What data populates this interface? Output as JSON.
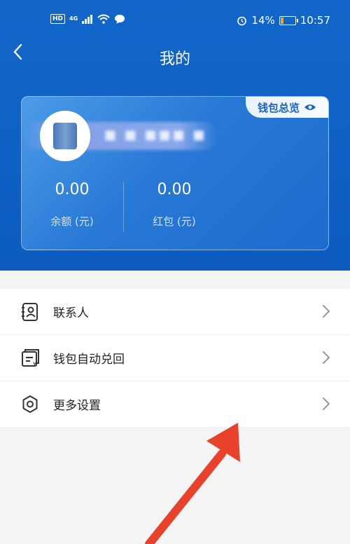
{
  "status_bar": {
    "hd": "HD",
    "network": "4G",
    "battery": "14%",
    "time": "10:57"
  },
  "nav": {
    "back_icon": "chevron-left-icon",
    "title": "我的"
  },
  "wallet": {
    "overview_label": "钱包总览",
    "overview_icon": "eye-icon",
    "balance_value": "0.00",
    "balance_label": "余额 (元)",
    "red_packet_value": "0.00",
    "red_packet_label": "红包 (元)"
  },
  "menu": [
    {
      "label": "联系人",
      "icon": "contacts-icon"
    },
    {
      "label": "钱包自动兑回",
      "icon": "wallet-exchange-icon"
    },
    {
      "label": "更多设置",
      "icon": "gear-icon"
    }
  ],
  "colors": {
    "header_bg": "#1366c9",
    "card_bg": "#2879d6",
    "tab_text": "#1862c4",
    "annotation": "#e8412c"
  }
}
